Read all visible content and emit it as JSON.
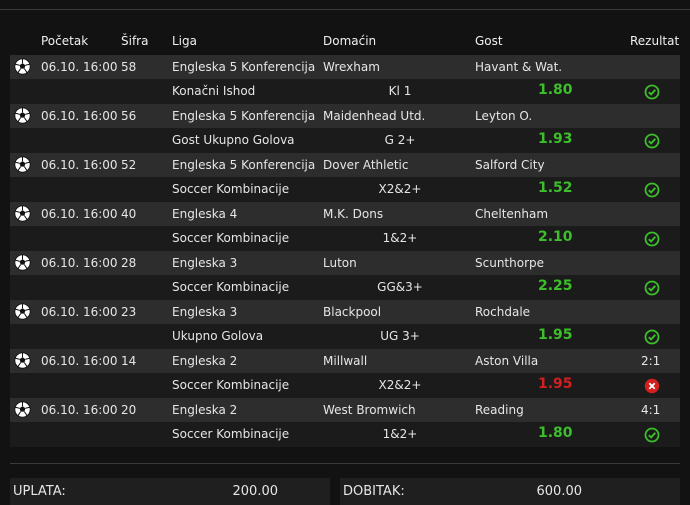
{
  "header": {
    "pocetak": "Početak",
    "sifra": "Šifra",
    "liga": "Liga",
    "domacin": "Domaćin",
    "gost": "Gost",
    "rezultat": "Rezultat"
  },
  "matches": [
    {
      "time": "06.10. 16:00",
      "code": "58",
      "league": "Engleska 5 Konferencija",
      "home": "Wrexham",
      "away": "Havant & Wat.",
      "market": "Konačni Ishod",
      "tip": "Kl 1",
      "odd": "1.80",
      "status": "win",
      "score": ""
    },
    {
      "time": "06.10. 16:00",
      "code": "56",
      "league": "Engleska 5 Konferencija",
      "home": "Maidenhead Utd.",
      "away": "Leyton O.",
      "market": "Gost Ukupno Golova",
      "tip": "G 2+",
      "odd": "1.93",
      "status": "win",
      "score": ""
    },
    {
      "time": "06.10. 16:00",
      "code": "52",
      "league": "Engleska 5 Konferencija",
      "home": "Dover Athletic",
      "away": "Salford City",
      "market": "Soccer Kombinacije",
      "tip": "X2&2+",
      "odd": "1.52",
      "status": "win",
      "score": ""
    },
    {
      "time": "06.10. 16:00",
      "code": "40",
      "league": "Engleska 4",
      "home": "M.K. Dons",
      "away": "Cheltenham",
      "market": "Soccer Kombinacije",
      "tip": "1&2+",
      "odd": "2.10",
      "status": "win",
      "score": ""
    },
    {
      "time": "06.10. 16:00",
      "code": "28",
      "league": "Engleska 3",
      "home": "Luton",
      "away": "Scunthorpe",
      "market": "Soccer Kombinacije",
      "tip": "GG&3+",
      "odd": "2.25",
      "status": "win",
      "score": ""
    },
    {
      "time": "06.10. 16:00",
      "code": "23",
      "league": "Engleska 3",
      "home": "Blackpool",
      "away": "Rochdale",
      "market": "Ukupno Golova",
      "tip": "UG 3+",
      "odd": "1.95",
      "status": "win",
      "score": ""
    },
    {
      "time": "06.10. 16:00",
      "code": "14",
      "league": "Engleska 2",
      "home": "Millwall",
      "away": "Aston Villa",
      "market": "Soccer Kombinacije",
      "tip": "X2&2+",
      "odd": "1.95",
      "status": "lose",
      "score": "2:1"
    },
    {
      "time": "06.10. 16:00",
      "code": "20",
      "league": "Engleska 2",
      "home": "West Bromwich",
      "away": "Reading",
      "market": "Soccer Kombinacije",
      "tip": "1&2+",
      "odd": "1.80",
      "status": "win",
      "score": "4:1"
    }
  ],
  "footer": {
    "uplata_label": "UPLATA:",
    "uplata_value": "200.00",
    "dobitak_label": "DOBITAK:",
    "dobitak_value": "600.00"
  },
  "colors": {
    "win": "#3cbf2a",
    "lose": "#d21f1f"
  }
}
